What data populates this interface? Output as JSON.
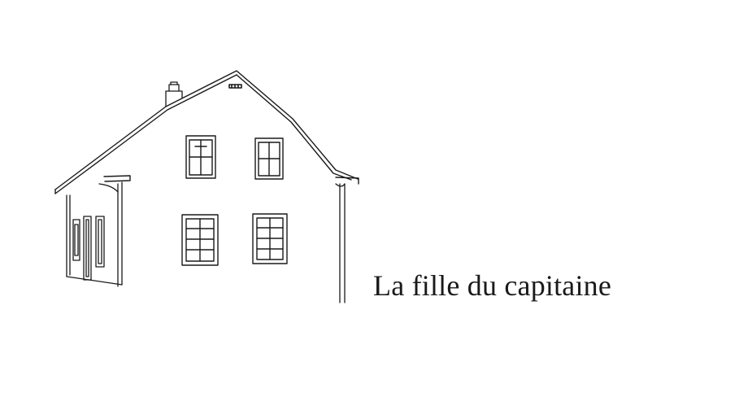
{
  "title": "La fille du capitaine",
  "illustration": {
    "subject": "house-line-drawing",
    "stroke_color": "#1a1a1a"
  },
  "background_color": "#ffffff"
}
